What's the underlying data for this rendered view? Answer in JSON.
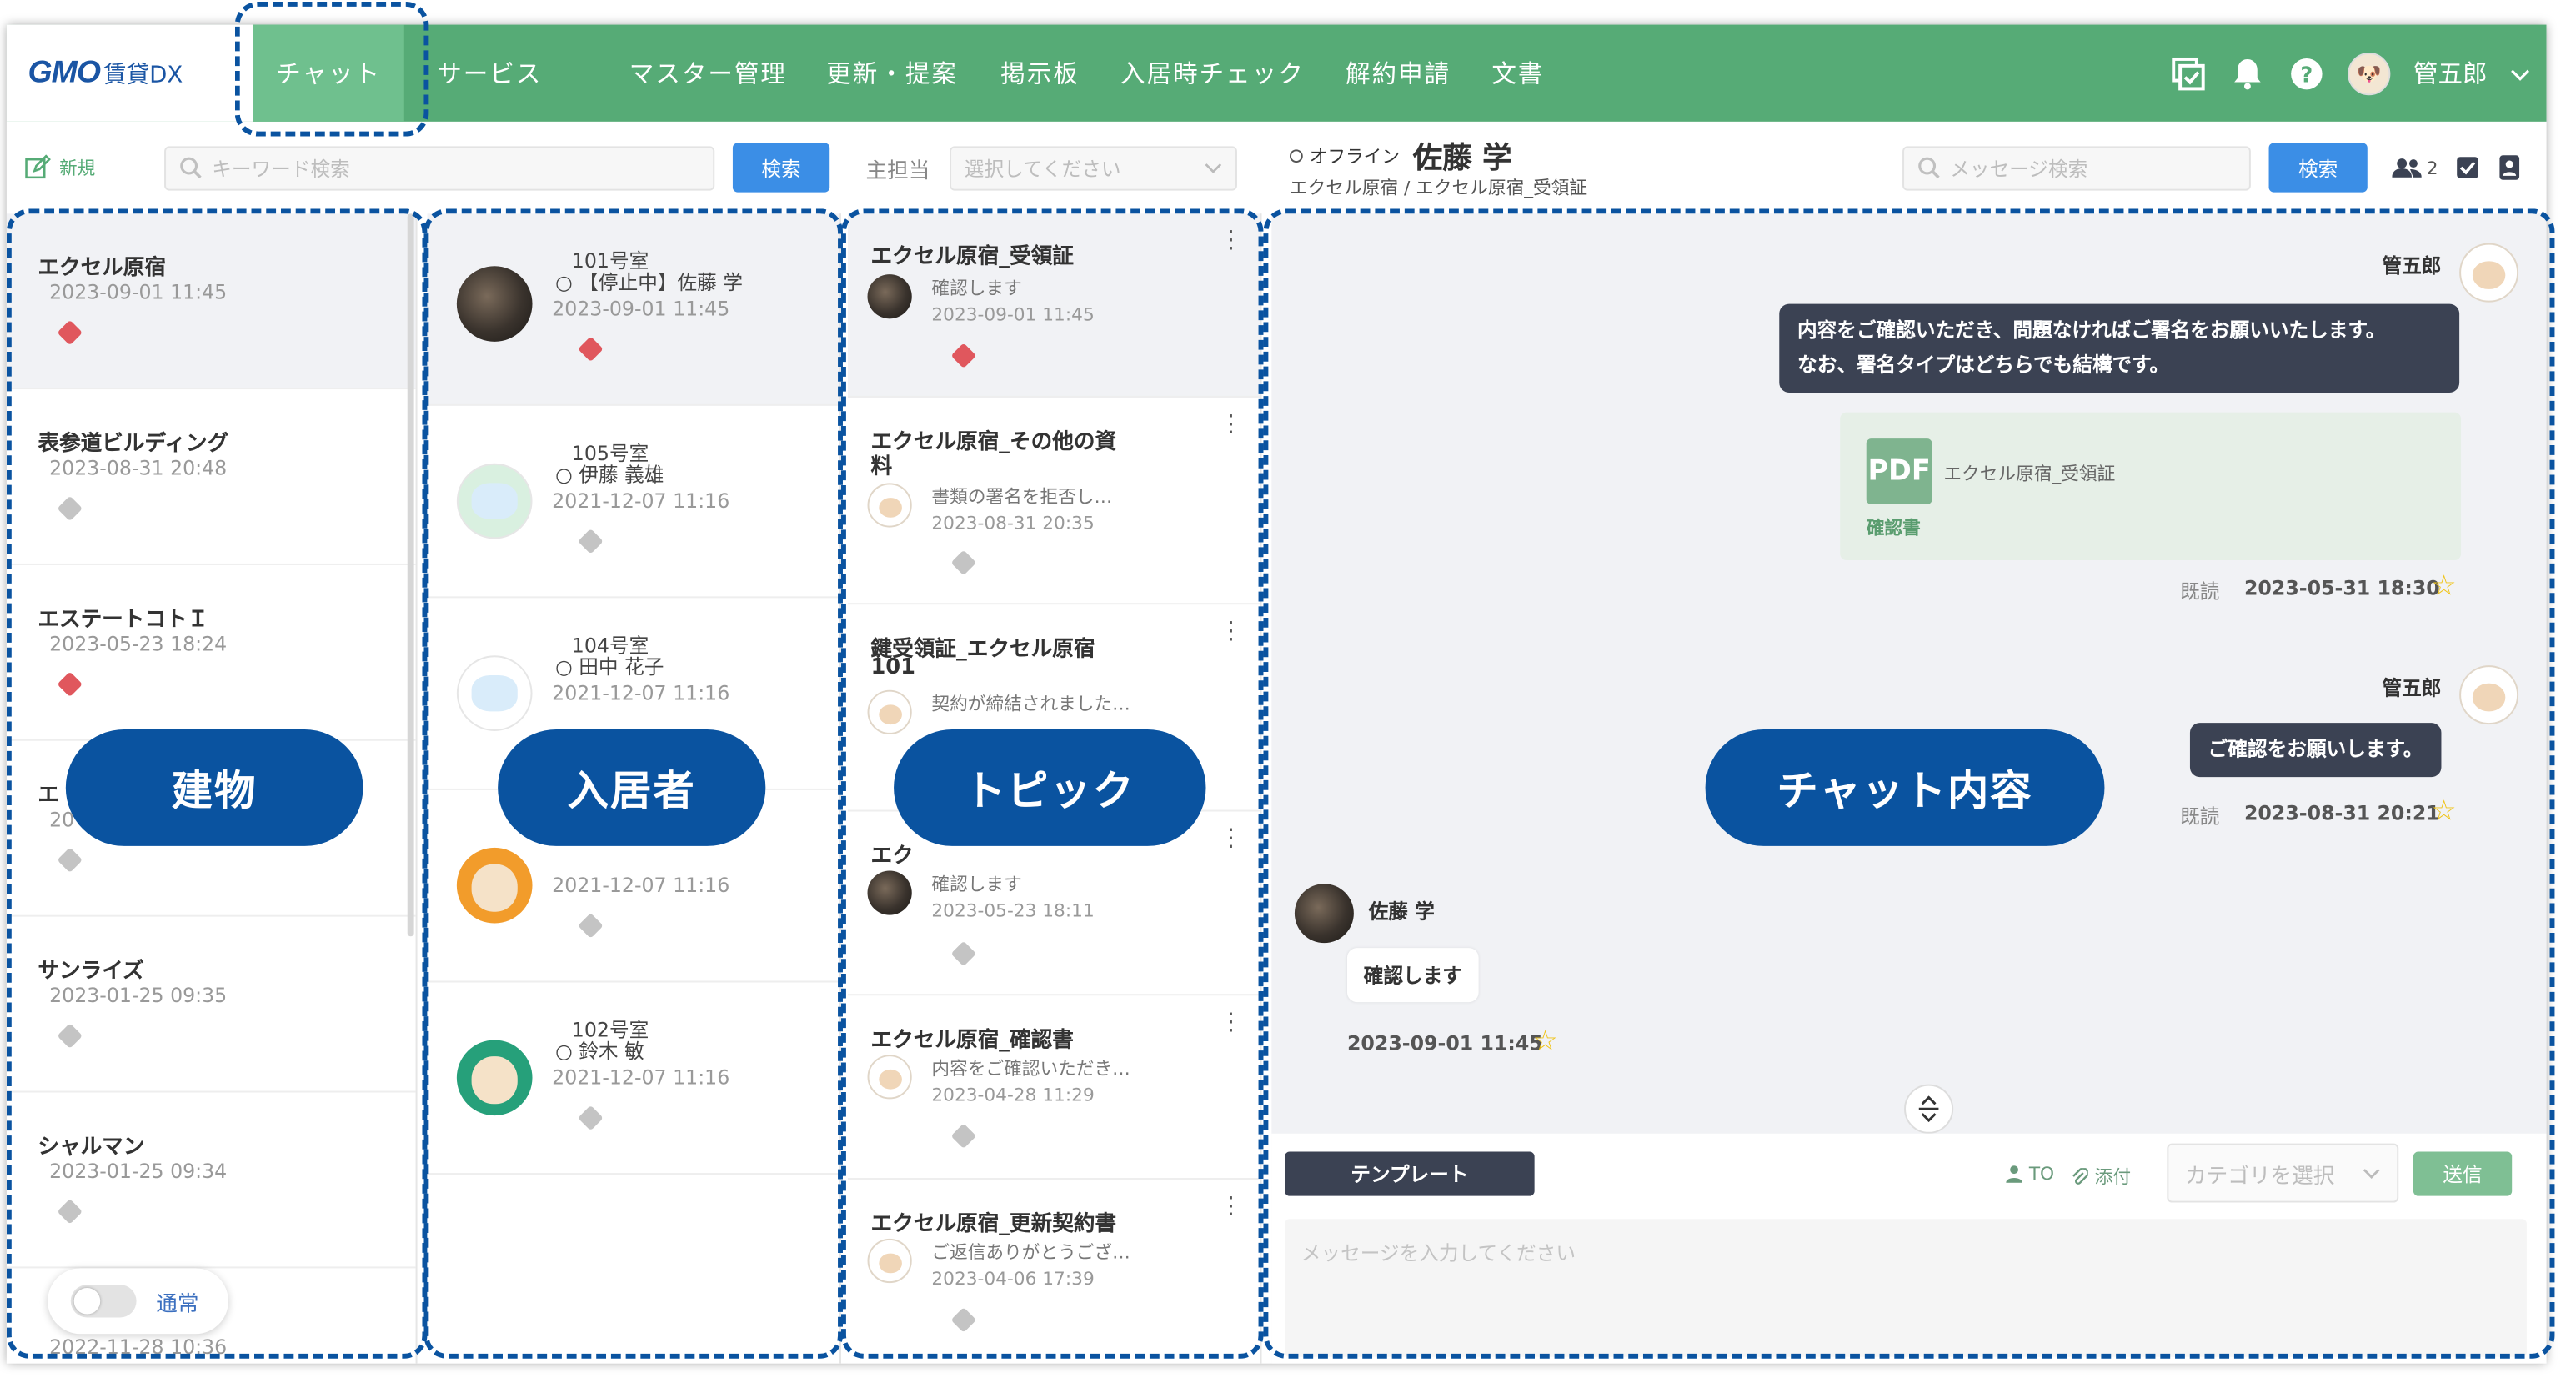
{
  "header": {
    "logo_gmo": "GMO",
    "logo_rest": "賃貸DX",
    "nav": [
      "チャット",
      "サービス",
      "マスター管理",
      "更新・提案",
      "掲示板",
      "入居時チェック",
      "解約申請",
      "文書"
    ],
    "user_name": "管五郎",
    "icons": [
      "task-window-icon",
      "bell-icon",
      "help-icon",
      "chevron-down-icon"
    ]
  },
  "toolbar": {
    "new_label": "新規",
    "keyword_placeholder": "キーワード検索",
    "search_label": "検索",
    "assignee_label": "主担当",
    "assignee_placeholder": "選択してください",
    "status": "オフライン",
    "contact_name": "佐藤 学",
    "breadcrumb": "エクセル原宿 / エクセル原宿_受領証",
    "message_search_placeholder": "メッセージ検索",
    "message_search_label": "検索",
    "member_count": "2"
  },
  "buildings": [
    {
      "name": "エクセル原宿",
      "date": "2023-09-01 11:45",
      "badge": "red"
    },
    {
      "name": "表参道ビルディング",
      "date": "2023-08-31 20:48",
      "badge": "gray"
    },
    {
      "name": "エステートコトＩ",
      "date": "2023-05-23 18:24",
      "badge": "red"
    },
    {
      "name": "エ",
      "date": "20",
      "badge": "gray"
    },
    {
      "name": "サンライズ",
      "date": "2023-01-25 09:35",
      "badge": "gray"
    },
    {
      "name": "シャルマン",
      "date": "2023-01-25 09:34",
      "badge": "gray"
    },
    {
      "name": "",
      "date": "2022-11-28 10:36",
      "badge": "none"
    }
  ],
  "toggle_label": "通常",
  "residents": [
    {
      "room": "101号室",
      "name": "【停止中】佐藤 学",
      "date": "2023-09-01 11:45",
      "badge": "red",
      "avatar": "cat"
    },
    {
      "room": "105号室",
      "name": "伊藤 義雄",
      "date": "2021-12-07 11:16",
      "badge": "gray",
      "avatar": "map"
    },
    {
      "room": "104号室",
      "name": "田中 花子",
      "date": "2021-12-07 11:16",
      "badge": "gray",
      "avatar": "dx"
    },
    {
      "room": "",
      "name": "",
      "date": "2021-12-07 11:16",
      "badge": "gray",
      "avatar": "dog-orange"
    },
    {
      "room": "102号室",
      "name": "鈴木 敏",
      "date": "2021-12-07 11:16",
      "badge": "gray",
      "avatar": "dog-teal"
    }
  ],
  "topics": [
    {
      "title": "エクセル原宿_受領証",
      "title2": "",
      "preview": "確認します",
      "date": "2023-09-01 11:45",
      "badge": "red",
      "avatar": "cat"
    },
    {
      "title": "エクセル原宿_その他の資",
      "title2": "料",
      "preview": "書類の署名を拒否し…",
      "date": "2023-08-31 20:35",
      "badge": "gray",
      "avatar": "dog"
    },
    {
      "title": "鍵受領証_エクセル原宿",
      "title2": "101",
      "preview": "契約が締結されました…",
      "date": "",
      "badge": "none",
      "avatar": "dog"
    },
    {
      "title": "エク",
      "title2": "",
      "preview": "確認します",
      "date": "2023-05-23 18:11",
      "badge": "gray",
      "avatar": "cat"
    },
    {
      "title": "エクセル原宿_確認書",
      "title2": "",
      "preview": "内容をご確認いただき…",
      "date": "2023-04-28 11:29",
      "badge": "gray",
      "avatar": "dog"
    },
    {
      "title": "エクセル原宿_更新契約書",
      "title2": "",
      "preview": "ご返信ありがとうござ…",
      "date": "2023-04-06 17:39",
      "badge": "gray",
      "avatar": "dog"
    }
  ],
  "chat": {
    "sender1": "管五郎",
    "msg1_line1": "内容をご確認いただき、問題なければご署名をお願いいたします。",
    "msg1_line2": "なお、署名タイプはどちらでも結構です。",
    "pdf_icon": "PDF",
    "pdf_name": "エクセル原宿_受領証",
    "pdf_type": "確認書",
    "read1": "既読",
    "time1": "2023-05-31 18:30",
    "sender2": "管五郎",
    "msg2": "ご確認をお願いします。",
    "read2": "既読",
    "time2": "2023-08-31 20:21",
    "sender3": "佐藤 学",
    "msg3": "確認します",
    "time3": "2023-09-01 11:45"
  },
  "composer": {
    "template_label": "テンプレート",
    "to_label": "TO",
    "attach_label": "添付",
    "category_placeholder": "カテゴリを選択",
    "send_label": "送信",
    "message_placeholder": "メッセージを入力してください"
  },
  "callouts": {
    "buildings": "建物",
    "residents": "入居者",
    "topics": "トピック",
    "chat": "チャット内容"
  },
  "colors": {
    "header_green": "#56ab76",
    "accent_blue": "#3b8ee6",
    "label_navy": "#0a53a0",
    "badge_red": "#e0575d"
  }
}
